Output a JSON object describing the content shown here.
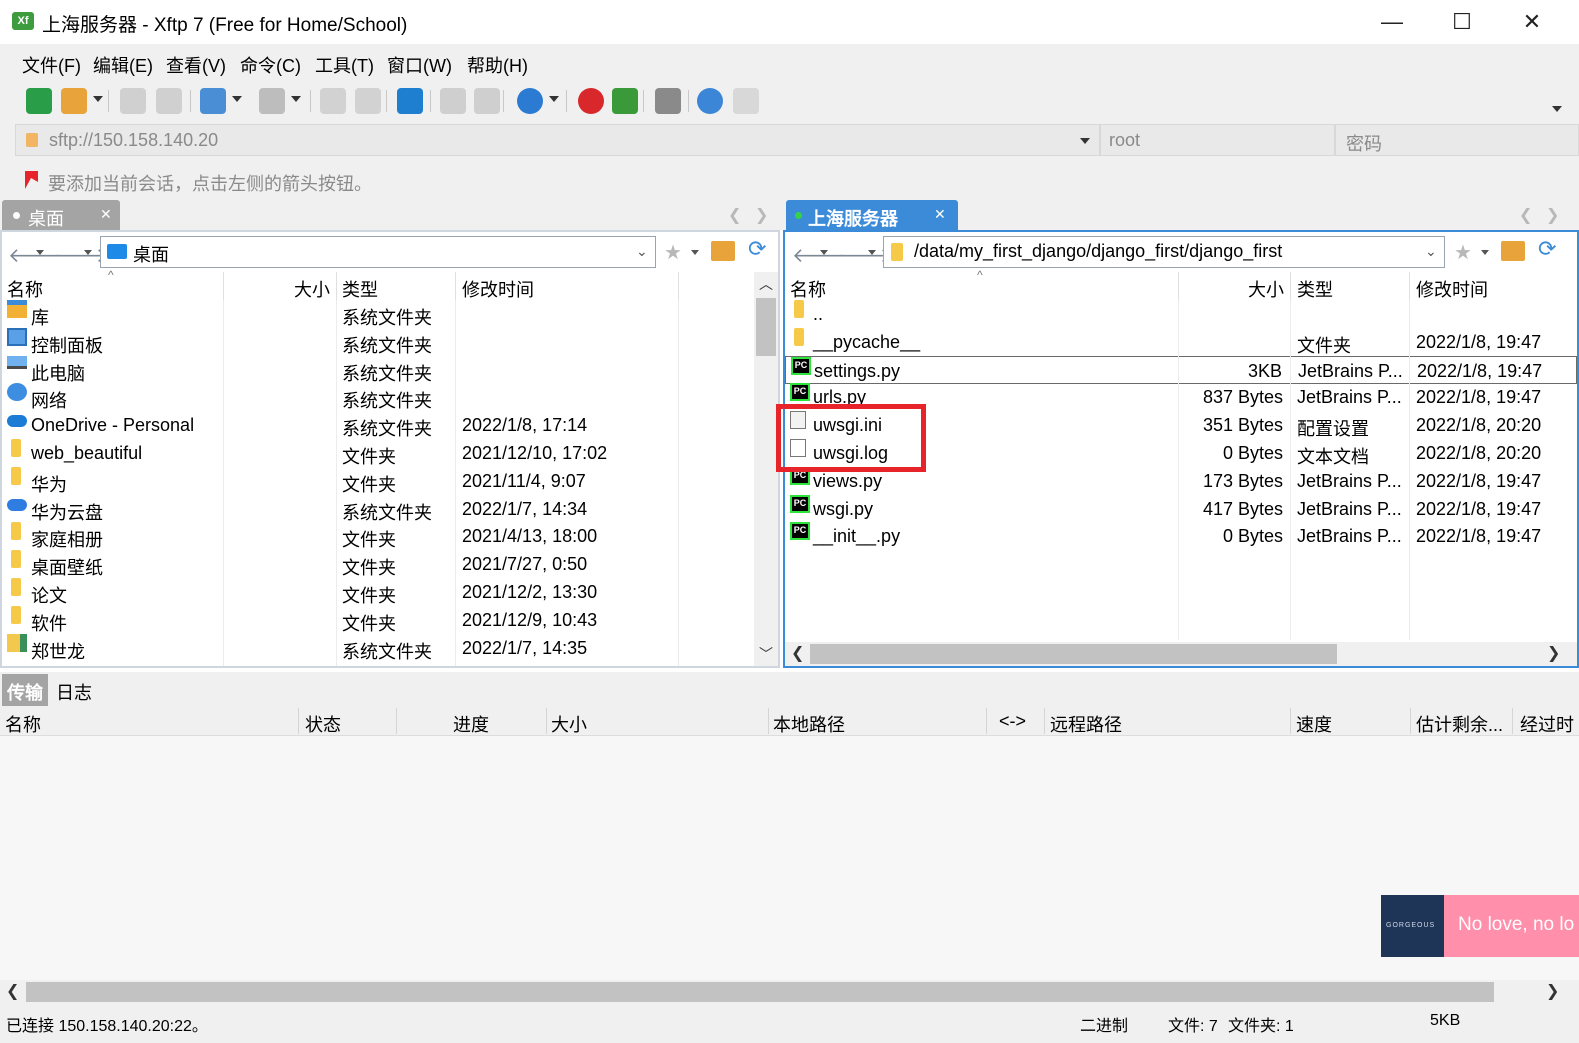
{
  "window": {
    "title": "上海服务器 - Xftp 7 (Free for Home/School)",
    "app_icon_label": "Xf",
    "minimize_glyph": "—",
    "maximize_glyph": "☐",
    "close_glyph": "✕"
  },
  "menu": [
    "文件(F)",
    "编辑(E)",
    "查看(V)",
    "命令(C)",
    "工具(T)",
    "窗口(W)",
    "帮助(H)"
  ],
  "toolbar_icons": [
    "new-session-icon",
    "open-folder-icon",
    "disconnect-icon",
    "reconnect-icon",
    "sync-icon",
    "terminal-icon",
    "upload-icon",
    "download-icon",
    "transfer-icon",
    "copy-icon",
    "paste-icon",
    "globe-icon",
    "xshell-icon",
    "xftp-icon",
    "settings-icon",
    "help-icon",
    "chat-icon"
  ],
  "address": {
    "url": "sftp://150.158.140.20",
    "user": "root",
    "password_placeholder": "密码"
  },
  "hint": "要添加当前会话，点击左侧的箭头按钮。",
  "left_pane": {
    "tab": "桌面",
    "path": "桌面",
    "columns": {
      "name": "名称",
      "size": "大小",
      "type": "类型",
      "modified": "修改时间"
    },
    "rows": [
      {
        "name": "库",
        "size": "",
        "type": "系统文件夹",
        "modified": "",
        "icon": "library-icon"
      },
      {
        "name": "控制面板",
        "size": "",
        "type": "系统文件夹",
        "modified": "",
        "icon": "control-panel-icon"
      },
      {
        "name": "此电脑",
        "size": "",
        "type": "系统文件夹",
        "modified": "",
        "icon": "computer-icon"
      },
      {
        "name": "网络",
        "size": "",
        "type": "系统文件夹",
        "modified": "",
        "icon": "network-icon"
      },
      {
        "name": "OneDrive - Personal",
        "size": "",
        "type": "系统文件夹",
        "modified": "2022/1/8, 17:14",
        "icon": "onedrive-icon"
      },
      {
        "name": "web_beautiful",
        "size": "",
        "type": "文件夹",
        "modified": "2021/12/10, 17:02",
        "icon": "folder-icon"
      },
      {
        "name": "华为",
        "size": "",
        "type": "文件夹",
        "modified": "2021/11/4, 9:07",
        "icon": "folder-icon"
      },
      {
        "name": "华为云盘",
        "size": "",
        "type": "系统文件夹",
        "modified": "2022/1/7, 14:34",
        "icon": "cloud-icon"
      },
      {
        "name": "家庭相册",
        "size": "",
        "type": "文件夹",
        "modified": "2021/4/13, 18:00",
        "icon": "folder-icon"
      },
      {
        "name": "桌面壁纸",
        "size": "",
        "type": "文件夹",
        "modified": "2021/7/27, 0:50",
        "icon": "folder-icon"
      },
      {
        "name": "论文",
        "size": "",
        "type": "文件夹",
        "modified": "2021/12/2, 13:30",
        "icon": "folder-icon"
      },
      {
        "name": "软件",
        "size": "",
        "type": "文件夹",
        "modified": "2021/12/9, 10:43",
        "icon": "folder-icon"
      },
      {
        "name": "郑世龙",
        "size": "",
        "type": "系统文件夹",
        "modified": "2022/1/7, 14:35",
        "icon": "user-folder-icon"
      }
    ]
  },
  "right_pane": {
    "tab": "上海服务器",
    "path": "/data/my_first_django/django_first/django_first",
    "columns": {
      "name": "名称",
      "size": "大小",
      "type": "类型",
      "modified": "修改时间"
    },
    "rows": [
      {
        "name": "..",
        "size": "",
        "type": "",
        "modified": "",
        "icon": "folder-icon"
      },
      {
        "name": "__pycache__",
        "size": "",
        "type": "文件夹",
        "modified": "2022/1/8, 19:47",
        "icon": "folder-icon"
      },
      {
        "name": "settings.py",
        "size": "3KB",
        "type": "JetBrains P...",
        "modified": "2022/1/8, 19:47",
        "icon": "pycharm-icon"
      },
      {
        "name": "urls.py",
        "size": "837 Bytes",
        "type": "JetBrains P...",
        "modified": "2022/1/8, 19:47",
        "icon": "pycharm-icon"
      },
      {
        "name": "uwsgi.ini",
        "size": "351 Bytes",
        "type": "配置设置",
        "modified": "2022/1/8, 20:20",
        "icon": "config-file-icon"
      },
      {
        "name": "uwsgi.log",
        "size": "0 Bytes",
        "type": "文本文档",
        "modified": "2022/1/8, 20:20",
        "icon": "text-file-icon"
      },
      {
        "name": "views.py",
        "size": "173 Bytes",
        "type": "JetBrains P...",
        "modified": "2022/1/8, 19:47",
        "icon": "pycharm-icon"
      },
      {
        "name": "wsgi.py",
        "size": "417 Bytes",
        "type": "JetBrains P...",
        "modified": "2022/1/8, 19:47",
        "icon": "pycharm-icon"
      },
      {
        "name": "__init__.py",
        "size": "0 Bytes",
        "type": "JetBrains P...",
        "modified": "2022/1/8, 19:47",
        "icon": "pycharm-icon"
      }
    ]
  },
  "bottom_tabs": [
    "传输",
    "日志"
  ],
  "transfer_columns": [
    "名称",
    "状态",
    "进度",
    "大小",
    "本地路径",
    "<->",
    "远程路径",
    "速度",
    "估计剩余...",
    "经过时"
  ],
  "notification": {
    "text": "No love, no lo",
    "art_label": "GORGEOUS"
  },
  "status": {
    "connection": "已连接 150.158.140.20:22。",
    "mode": "二进制",
    "files": "文件: 7",
    "folders": "文件夹: 1",
    "size": "5KB"
  },
  "colors": {
    "accent": "#3b8bd8",
    "highlight": "#e8242b",
    "pycharm_green": "#2ee33b",
    "folder": "#f7c948"
  }
}
